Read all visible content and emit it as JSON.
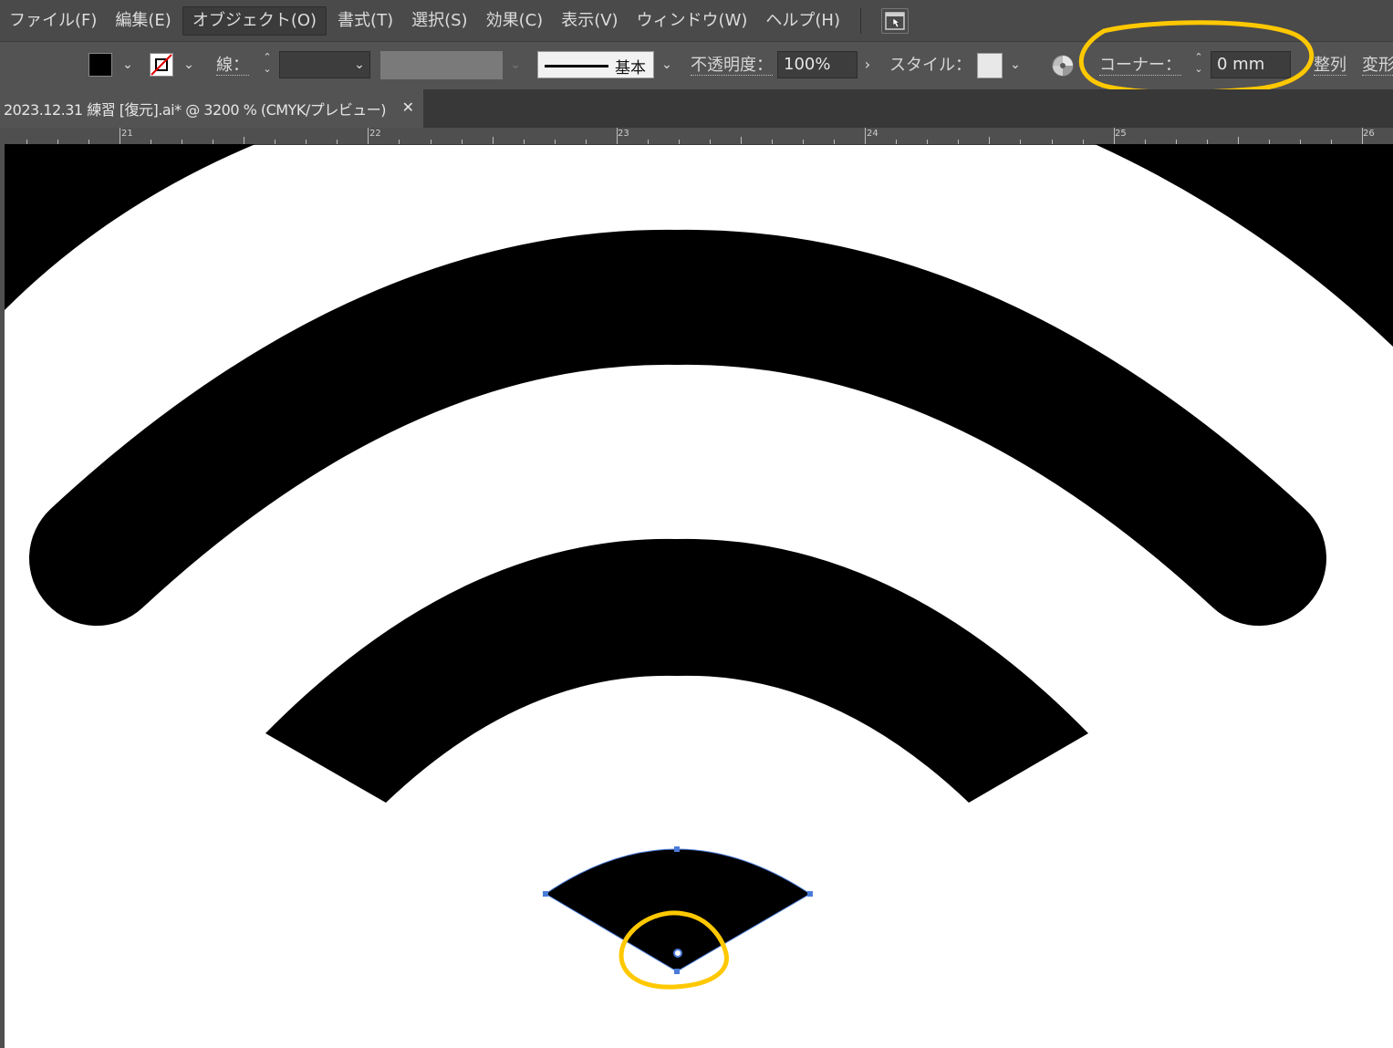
{
  "menu": {
    "items": [
      "ファイル(F)",
      "編集(E)",
      "オブジェクト(O)",
      "書式(T)",
      "選択(S)",
      "効果(C)",
      "表示(V)",
      "ウィンドウ(W)",
      "ヘルプ(H)"
    ]
  },
  "control": {
    "stroke_label": "線：",
    "profile_label": "基本",
    "opacity_label": "不透明度：",
    "opacity_value": "100%",
    "style_label": "スタイル：",
    "corner_label": "コーナー：",
    "corner_value": "0 mm",
    "align_label": "整列",
    "transform_label": "変形"
  },
  "document": {
    "tab_title": "2023.12.31 練習 [復元].ai* @ 3200 % (CMYK/プレビュー)",
    "close_glyph": "✕"
  },
  "ruler": {
    "labels": [
      "21",
      "22",
      "23",
      "24",
      "25",
      "26"
    ]
  },
  "colors": {
    "annotation": "#ffc800",
    "selection": "#4a7bd8",
    "fill": "#000000"
  },
  "icons": {
    "fill_swatch": "black-square-icon",
    "stroke_swatch": "no-stroke-icon",
    "recolor": "recolor-artwork-icon",
    "arrange": "arrange-documents-icon"
  }
}
